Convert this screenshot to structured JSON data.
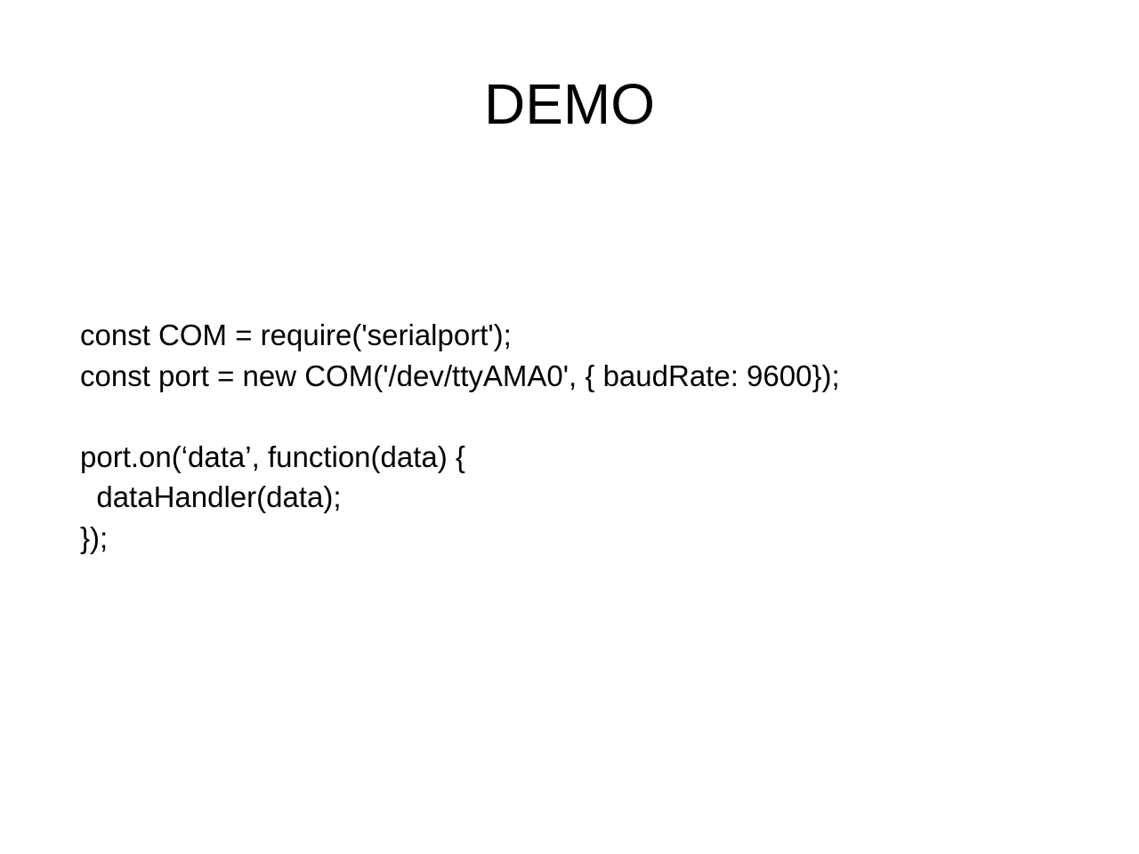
{
  "slide": {
    "title": "DEMO",
    "code": "const COM = require('serialport');\nconst port = new COM('/dev/ttyAMA0', { baudRate: 9600});\n\nport.on(‘data’, function(data) {\n  dataHandler(data);\n});"
  }
}
